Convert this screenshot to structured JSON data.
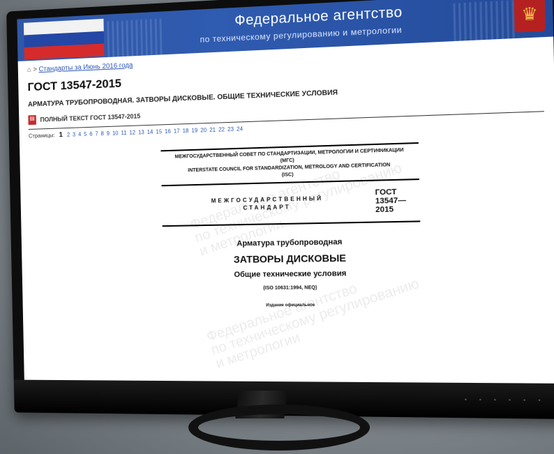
{
  "header": {
    "title": "Федеральное агентство",
    "subtitle": "по техническому регулированию и метрологии"
  },
  "breadcrumb": {
    "home_icon": "home-icon",
    "link": "Стандарты за Июнь 2016 года"
  },
  "page": {
    "title": "ГОСТ 13547-2015",
    "subtitle": "АРМАТУРА ТРУБОПРОВОДНАЯ. ЗАТВОРЫ ДИСКОВЫЕ. ОБЩИЕ ТЕХНИЧЕСКИЕ УСЛОВИЯ",
    "pdf_link": "ПОЛНЫЙ ТЕКСТ ГОСТ 13547-2015"
  },
  "pagination": {
    "label": "Страницы:",
    "current": "1",
    "pages": [
      "2",
      "3",
      "4",
      "5",
      "6",
      "7",
      "8",
      "9",
      "10",
      "11",
      "12",
      "13",
      "14",
      "15",
      "16",
      "17",
      "18",
      "19",
      "20",
      "21",
      "22",
      "23",
      "24"
    ]
  },
  "document": {
    "council_ru": "МЕЖГОСУДАРСТВЕННЫЙ СОВЕТ ПО СТАНДАРТИЗАЦИИ, МЕТРОЛОГИИ И СЕРТИФИКАЦИИ",
    "council_ru_abbr": "(МГС)",
    "council_en": "INTERSTATE COUNCIL FOR STANDARDIZATION, METROLOGY AND CERTIFICATION",
    "council_en_abbr": "(ISC)",
    "standard_type_1": "МЕЖГОСУДАРСТВЕННЫЙ",
    "standard_type_2": "СТАНДАРТ",
    "gost_1": "ГОСТ",
    "gost_2": "13547—",
    "gost_3": "2015",
    "title_1": "Арматура трубопроводная",
    "title_2": "ЗАТВОРЫ ДИСКОВЫЕ",
    "title_3": "Общие технические условия",
    "iso": "(ISO 10631:1994, NEQ)",
    "edition": "Издание официальное"
  },
  "watermark": {
    "lines": [
      "Федеральное агентство",
      "по техническому регулированию",
      "и метрологии"
    ]
  }
}
